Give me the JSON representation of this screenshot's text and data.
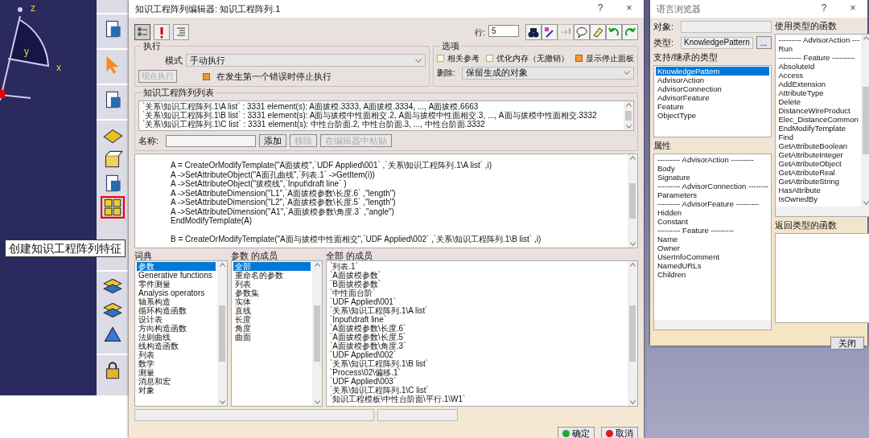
{
  "viewport": {
    "axis_labels": [
      "z",
      "y",
      "x"
    ]
  },
  "toolbar": {
    "groups": [
      [
        {
          "kind": "document",
          "highlighted": false
        }
      ],
      [
        {
          "kind": "cursor",
          "highlighted": false
        }
      ],
      [
        {
          "kind": "document",
          "highlighted": false
        }
      ],
      [
        {
          "kind": "sketch",
          "highlighted": false
        },
        {
          "kind": "box",
          "highlighted": false
        },
        {
          "kind": "document",
          "highlighted": false
        },
        {
          "kind": "grid",
          "highlighted": true
        }
      ],
      [
        {
          "kind": "layers",
          "highlighted": false
        },
        {
          "kind": "layers",
          "highlighted": false
        },
        {
          "kind": "shape",
          "highlighted": false
        }
      ],
      [
        {
          "kind": "lock",
          "highlighted": false
        }
      ]
    ]
  },
  "tooltip": {
    "text": "创建知识工程阵列特征"
  },
  "editor": {
    "title": "知识工程阵列编辑器: 知识工程阵列.1",
    "help": "?",
    "close": "×",
    "mode_buttons": [
      {
        "kind": "tree",
        "selected": true
      },
      {
        "kind": "exclaim",
        "selected": false
      },
      {
        "kind": "text",
        "selected": false
      }
    ],
    "line_label": "行:",
    "line_value": "5",
    "tool_buttons": [
      {
        "kind": "binoculars",
        "disabled": false
      },
      {
        "kind": "wand",
        "disabled": false
      },
      {
        "kind": "arrow",
        "disabled": true
      },
      {
        "kind": "bubble",
        "disabled": false
      },
      {
        "kind": "eraser",
        "disabled": false
      },
      {
        "kind": "undo",
        "disabled": false
      },
      {
        "kind": "redo",
        "disabled": false
      }
    ],
    "execution": {
      "legend": "执行",
      "mode_label": "模式",
      "mode_value": "手动执行",
      "run_button": {
        "label": "现在执行",
        "disabled": true
      },
      "stop_on_error": {
        "label": "在发生第一个错误时停止执行",
        "checked": true
      }
    },
    "options": {
      "legend": "选项",
      "checkboxes": [
        {
          "label": "相关参考",
          "checked": false
        },
        {
          "label": "优化内存（无撤销）",
          "checked": false
        },
        {
          "label": "显示停止面板",
          "checked": true
        }
      ],
      "delete_label": "删除:",
      "delete_value": "保留生成的对象"
    },
    "pattern_list": {
      "legend": "知识工程阵列列表",
      "rows": [
        "`关系\\知识工程阵列.1\\A list` : 3331 element(s): A面拔模.3333, A面拔模.3334, ..., A面拔模.6663",
        "`关系\\知识工程阵列.1\\B list` : 3331 element(s): A面与拔模中性面相交.2, A面与拔模中性面相交.3, ..., A面与拔模中性面相交.3332",
        "`关系\\知识工程阵列.1\\C list` : 3331 element(s): 中性台阶面.2, 中性台阶面.3, ..., 中性台阶面.3332"
      ],
      "name_label": "名称:",
      "buttons": [
        {
          "label": "添加",
          "disabled": false
        },
        {
          "label": "移除",
          "disabled": true
        },
        {
          "label": "在编辑器中粘贴",
          "disabled": true
        }
      ]
    },
    "code": {
      "blocks": [
        [
          "A = CreateOrModifyTemplate(\"A面拔模\",`UDF Applied\\001` ,`关系\\知识工程阵列.1\\A list` ,i)",
          "A ->SetAttributeObject(\"A面孔曲线\",`列表.1` ->GetItem(i))",
          "A ->SetAttributeObject(\"拔模线\",`Input\\draft line` )",
          "A ->SetAttributeDimension(\"L1\",`A面拔模参数\\长度.6` ,\"length\")",
          "A ->SetAttributeDimension(\"L2\",`A面拔模参数\\长度.5` ,\"length\")",
          "A ->SetAttributeDimension(\"A1\",`A面拔模参数\\角度.3` ,\"angle\")",
          "EndModifyTemplate(A)"
        ],
        [
          "B = CreateOrModifyTemplate(\"A面与拔模中性面相交\",`UDF Applied\\002` ,`关系\\知识工程阵列.1\\B list` ,i)"
        ]
      ]
    },
    "dictionary": {
      "title": "词典",
      "items": [
        {
          "label": "参数",
          "selected": true
        },
        {
          "label": "Generative functions",
          "selected": false
        },
        {
          "label": "零件测量",
          "selected": false
        },
        {
          "label": "Analysis operators",
          "selected": false
        },
        {
          "label": "轴系构造",
          "selected": false
        },
        {
          "label": "循环构造函数",
          "selected": false
        },
        {
          "label": "设计表",
          "selected": false
        },
        {
          "label": "方向构造函数",
          "selected": false
        },
        {
          "label": "法则曲线",
          "selected": false
        },
        {
          "label": "线构造函数",
          "selected": false
        },
        {
          "label": "列表",
          "selected": false
        },
        {
          "label": "数学",
          "selected": false
        },
        {
          "label": "测量",
          "selected": false
        },
        {
          "label": "消息和宏",
          "selected": false
        },
        {
          "label": "对象",
          "selected": false
        }
      ]
    },
    "members": {
      "title": "参数 的成员",
      "items": [
        {
          "label": "全部",
          "selected": true
        },
        {
          "label": "重命名的参数",
          "selected": false
        },
        {
          "label": "列表",
          "selected": false
        },
        {
          "label": "参数集",
          "selected": false
        },
        {
          "label": "实体",
          "selected": false
        },
        {
          "label": "直线",
          "selected": false
        },
        {
          "label": "长度",
          "selected": false
        },
        {
          "label": "角度",
          "selected": false
        },
        {
          "label": "曲面",
          "selected": false
        }
      ]
    },
    "all_members": {
      "title": "全部 的成员",
      "items": [
        "`列表.1`",
        "`A面拔模参数`",
        "`B面拔模参数`",
        "`中性面台阶`",
        "`UDF Applied\\001`",
        "`关系\\知识工程阵列.1\\A list`",
        "`Input\\draft line`",
        "`A面拔模参数\\长度.6`",
        "`A面拔模参数\\长度.5`",
        "`A面拔模参数\\角度.3`",
        "`UDF Applied\\002`",
        "`关系\\知识工程阵列.1\\B list`",
        "`Process\\02\\偏移.1`",
        "`UDF Applied\\003`",
        "`关系\\知识工程阵列.1\\C list`",
        "`知识工程模板\\中性台阶面\\平行.1\\W1`"
      ]
    },
    "buttons": [
      {
        "kind": "ok",
        "label": "确定"
      },
      {
        "kind": "cancel",
        "label": "取消"
      }
    ]
  },
  "browser": {
    "title": "语言浏览器",
    "help": "?",
    "close": "×",
    "object_label": "对象:",
    "type_label": "类型:",
    "type_value": "KnowledgePattern",
    "browse_button": "...",
    "types": {
      "title": "支持/继承的类型",
      "items": [
        {
          "label": "KnowledgePattern",
          "selected": true
        },
        {
          "label": "AdvisorAction",
          "selected": false
        },
        {
          "label": "AdvisorConnection",
          "selected": false
        },
        {
          "label": "AdvisorFeature",
          "selected": false
        },
        {
          "label": "Feature",
          "selected": false
        },
        {
          "label": "ObjectType",
          "selected": false
        }
      ]
    },
    "attributes": {
      "title": "属性",
      "items": [
        "--------- AdvisorAction ---------",
        "Body",
        "Signature",
        "--------- AdvisorConnection --------",
        "Parameters",
        "--------- AdvisorFeature ---------",
        "Hidden",
        "Constant",
        "--------- Feature ---------",
        "Name",
        "Owner",
        "UserInfoComment",
        "NamedURLs",
        "Children"
      ]
    },
    "functions": {
      "title": "使用类型的函数",
      "items": [
        "--------- AdvisorAction ---",
        "Run",
        "--------- Feature ---------",
        "AbsoluteId",
        "Access",
        "AddExtension",
        "AttributeType",
        "Delete",
        "DistanceWireProduct",
        "Elec_DistanceCommon",
        "EndModifyTemplate",
        "Find",
        "GetAttributeBoolean",
        "GetAttributeInteger",
        "GetAttributeObject",
        "GetAttributeReal",
        "GetAttributeString",
        "HasAttribute",
        "IsOwnedBy"
      ]
    },
    "return_functions": {
      "title": "返回类型的函数"
    },
    "close_button": "关闭"
  }
}
